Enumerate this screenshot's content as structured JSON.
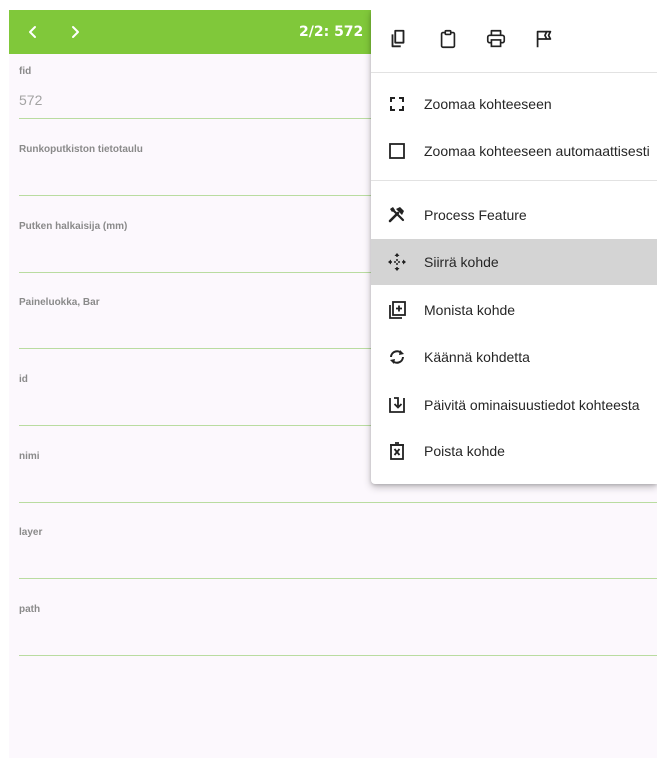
{
  "header": {
    "counter": "2/2: 572",
    "accent": "#80c83a"
  },
  "fields": [
    {
      "label": "fid",
      "value": "572"
    },
    {
      "label": "Runkoputkiston tietotaulu",
      "value": ""
    },
    {
      "label": "Putken halkaisija (mm)",
      "value": ""
    },
    {
      "label": "Paineluokka, Bar",
      "value": ""
    },
    {
      "label": "id",
      "value": ""
    },
    {
      "label": "nimi",
      "value": ""
    },
    {
      "label": "layer",
      "value": ""
    },
    {
      "label": "path",
      "value": ""
    }
  ],
  "menu": {
    "toolbar": [
      "copy-icon",
      "paste-icon",
      "print-icon",
      "flag-icon"
    ],
    "items": [
      {
        "label": "Zoomaa kohteeseen",
        "icon": "zoom-to-icon"
      },
      {
        "label": "Zoomaa kohteeseen automaattisesti",
        "icon": "checkbox-icon"
      },
      {
        "label": "Process Feature",
        "icon": "tools-icon"
      },
      {
        "label": "Siirrä kohde",
        "icon": "move-icon",
        "active": true
      },
      {
        "label": "Monista kohde",
        "icon": "duplicate-icon"
      },
      {
        "label": "Käännä kohdetta",
        "icon": "rotate-icon"
      },
      {
        "label": "Päivitä ominaisuustiedot kohteesta",
        "icon": "update-attributes-icon"
      },
      {
        "label": "Poista kohde",
        "icon": "delete-icon"
      }
    ]
  }
}
